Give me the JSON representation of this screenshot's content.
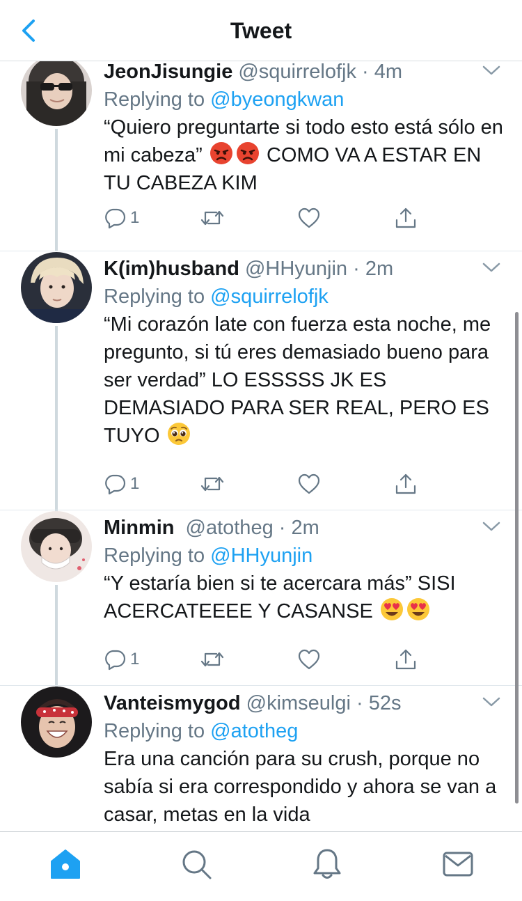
{
  "header": {
    "title": "Tweet"
  },
  "tweets": [
    {
      "name": "JeonJisungie",
      "handle": "@squirrelofjk",
      "time": "4m",
      "replying_prefix": "Replying to",
      "replying_to": "@byeongkwan",
      "text_1": "“Quiero preguntarte si todo esto está sólo en mi cabeza”",
      "text_2": " COMO VA A ESTAR EN TU CABEZA KIM",
      "emoji": "angry-face",
      "reply_count": "1"
    },
    {
      "name": "K(im)husband",
      "handle": "@HHyunjin",
      "time": "2m",
      "replying_prefix": "Replying to",
      "replying_to": "@squirrelofjk",
      "text_1": "“Mi corazón late con fuerza esta noche, me pregunto, si tú eres demasiado bueno para ser verdad” LO ESSSSS JK ES DEMASIADO PARA SER REAL, PERO ES TUYO",
      "emoji": "pleading-face",
      "reply_count": "1"
    },
    {
      "name": "Minmin",
      "handle": "@atotheg",
      "time": "2m",
      "replying_prefix": "Replying to",
      "replying_to": "@HHyunjin",
      "text_1": "“Y estaría bien si te acercara más” SISI ACERCATEEEE Y CASANSE",
      "emoji": "heart-eyes-face",
      "reply_count": "1"
    },
    {
      "name": "Vanteismygod",
      "handle": "@kimseulgi",
      "time": "52s",
      "replying_prefix": "Replying to",
      "replying_to": "@atotheg",
      "text_1": "Era una canción para su crush, porque no sabía si era correspondido y ahora se van a casar, metas en la vida"
    }
  ],
  "separator": "·",
  "colors": {
    "accent": "#1da1f2",
    "secondary_text": "#657786",
    "text": "#14171a"
  },
  "tabs": [
    {
      "icon": "home-icon",
      "active": true
    },
    {
      "icon": "search-icon",
      "active": false
    },
    {
      "icon": "bell-icon",
      "active": false
    },
    {
      "icon": "mail-icon",
      "active": false
    }
  ]
}
